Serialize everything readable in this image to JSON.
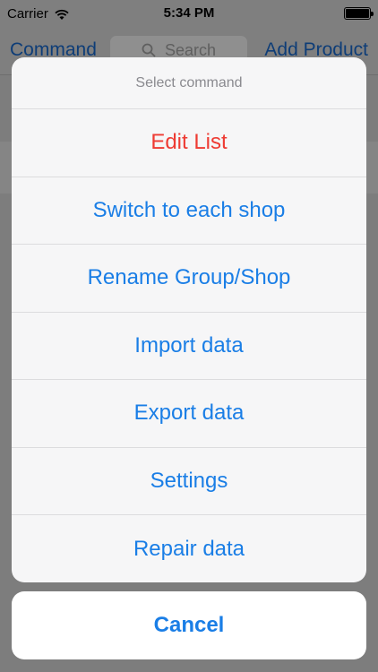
{
  "status_bar": {
    "carrier": "Carrier",
    "time": "5:34 PM"
  },
  "nav_bar": {
    "left_label": "Command",
    "search_placeholder": "Search",
    "right_label": "Add Product"
  },
  "action_sheet": {
    "title": "Select command",
    "items": [
      {
        "label": "Edit List",
        "style": "destructive"
      },
      {
        "label": "Switch to each shop",
        "style": "default"
      },
      {
        "label": "Rename Group/Shop",
        "style": "default"
      },
      {
        "label": "Import data",
        "style": "default"
      },
      {
        "label": "Export data",
        "style": "default"
      },
      {
        "label": "Settings",
        "style": "default"
      },
      {
        "label": "Repair data",
        "style": "default"
      }
    ],
    "cancel_label": "Cancel"
  },
  "colors": {
    "accent": "#1a7ee6",
    "destructive": "#ee3b33",
    "dim_overlay": "#7d7d7d"
  }
}
